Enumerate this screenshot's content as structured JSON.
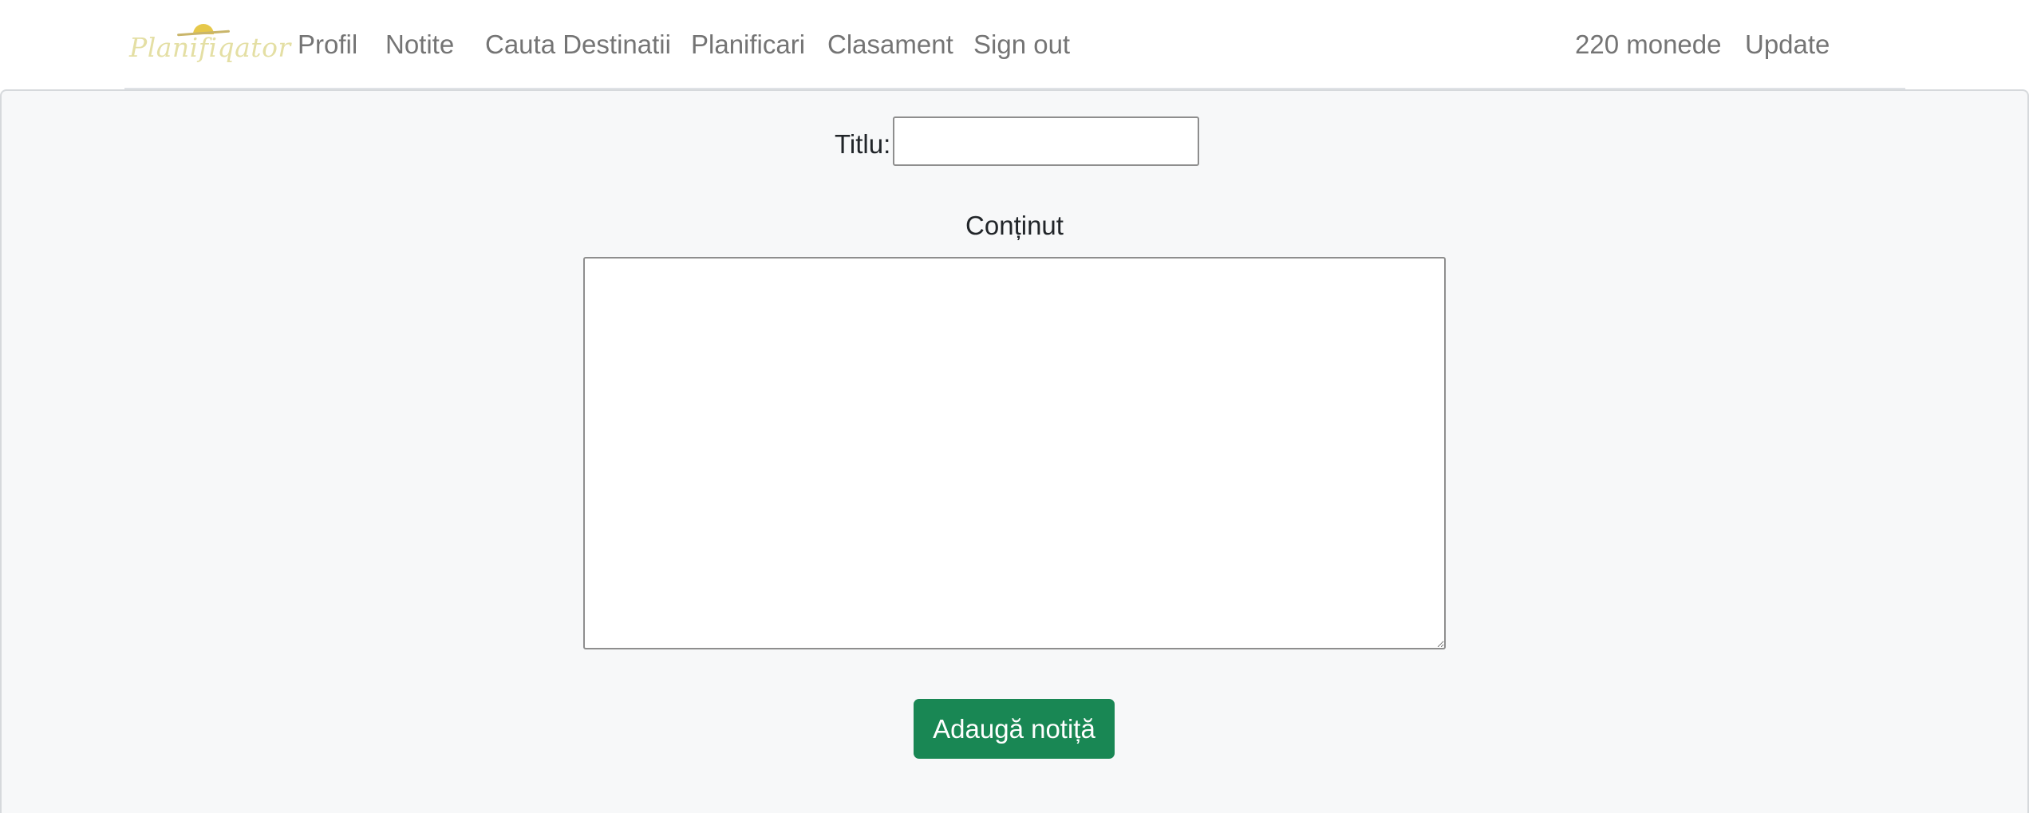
{
  "brand": {
    "logo_text": "Planifiqator"
  },
  "nav": {
    "left_items": [
      {
        "label": "Profil"
      },
      {
        "label": "Notite"
      },
      {
        "label": "Cauta Destinatii"
      },
      {
        "label": "Planificari"
      },
      {
        "label": "Clasament"
      },
      {
        "label": "Sign out"
      }
    ],
    "coins": "220 monede",
    "update": "Update"
  },
  "form": {
    "title_label": "Titlu:",
    "title_value": "",
    "content_label": "Conținut",
    "content_value": "",
    "submit_label": "Adaugă notiță"
  },
  "colors": {
    "nav_link": "#747474",
    "panel_background": "#f7f8f9",
    "submit_button": "#198754",
    "brand_text": "#e4dfa4"
  }
}
